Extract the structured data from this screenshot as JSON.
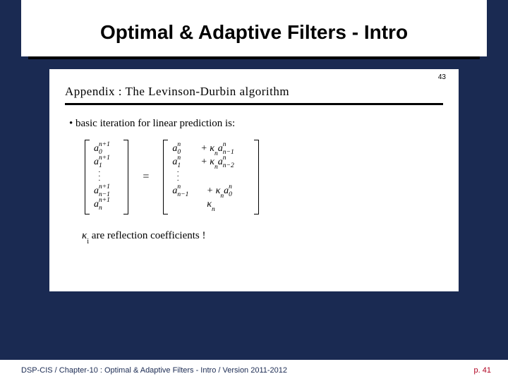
{
  "slide": {
    "title": "Optimal & Adaptive Filters - Intro"
  },
  "inner": {
    "page_num": "43",
    "heading": "Appendix : The Levinson-Durbin algorithm",
    "bullet": "• basic iteration for linear prediction is:",
    "lhs": {
      "r1": {
        "base": "a",
        "sub": "0",
        "sup": "n+1"
      },
      "r2": {
        "base": "a",
        "sub": "1",
        "sup": "n+1"
      },
      "r3": {
        "base": "a",
        "sub": "n−1",
        "sup": "n+1"
      },
      "r4": {
        "base": "a",
        "sub": "n",
        "sup": "n+1"
      }
    },
    "rhs": {
      "r1": {
        "t1_base": "a",
        "t1_sub": "0",
        "t1_sup": "n",
        "plus": " + ",
        "kappa": "κ",
        "ksub": "n",
        "t2_base": "a",
        "t2_sub": "n−1",
        "t2_sup": "n"
      },
      "r2": {
        "t1_base": "a",
        "t1_sub": "1",
        "t1_sup": "n",
        "plus": " + ",
        "kappa": "κ",
        "ksub": "n",
        "t2_base": "a",
        "t2_sub": "n−2",
        "t2_sup": "n"
      },
      "r3": {
        "t1_base": "a",
        "t1_sub": "n−1",
        "t1_sup": "n",
        "plus": " + ",
        "kappa": "κ",
        "ksub": "n",
        "t2_base": "a",
        "t2_sub": "0",
        "t2_sup": "n"
      },
      "r4": {
        "kappa": "κ",
        "ksub": "n"
      }
    },
    "eq_sign": "=",
    "reflection_pre": "κ",
    "reflection_sub": "i",
    "reflection_text": " are reflection coefficients !"
  },
  "footer": {
    "left": "DSP-CIS / Chapter-10 : Optimal & Adaptive Filters - Intro / Version 2011-2012",
    "right": "p. 41"
  }
}
